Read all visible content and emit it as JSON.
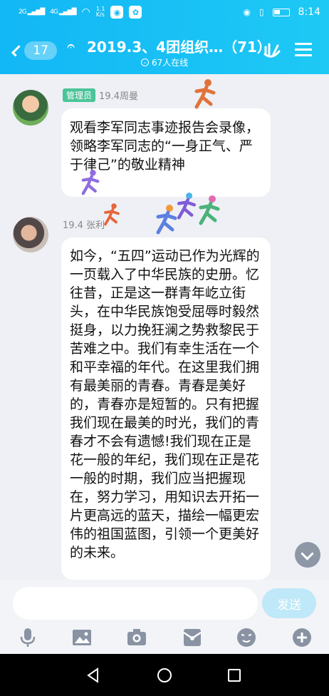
{
  "status_bar": {
    "signal1": "2G",
    "signal2": "4G",
    "net_speed_value": "1.1",
    "net_speed_unit": "K/s",
    "time": "8:14"
  },
  "header": {
    "unread_count": "17",
    "title": "2019.3、4团组织…（71）",
    "online": "67人在线"
  },
  "messages": [
    {
      "badge": "管理员",
      "sender": "19.4周曼",
      "text": "观看李军同志事迹报告会录像，领略李军同志的“一身正气、严于律己”的敬业精神"
    },
    {
      "badge": "",
      "sender": "19.4 张利",
      "text": "如今，“五四”运动已作为光辉的一页载入了中华民族的史册。忆往昔，正是这一群青年屹立街头，在中华民族饱受屈辱时毅然挺身，以力挽狂澜之势救黎民于苦难之中。我们有幸生活在一个和平幸福的年代。在这里我们拥有最美丽的青春。青春是美好的，青春亦是短暂的。只有把握我们现在最美的时光，我们的青春才不会有遗憾!我们现在正是花一般的年纪，我们现在正是花一般的时期，我们应当把握现在，努力学习，用知识去开拓一片更高远的蓝天，描绘一幅更宏伟的祖国蓝图，引领一个更美好的未来。"
    }
  ],
  "input": {
    "placeholder": "",
    "send_label": "发送"
  },
  "colors": {
    "header": "#12b7f5",
    "admin_badge": "#4cc49a",
    "send_disabled": "#bfe8f8"
  },
  "icons": {
    "toolbar": [
      "microphone-icon",
      "image-icon",
      "camera-icon",
      "red-packet-icon",
      "emoji-icon",
      "plus-icon"
    ],
    "nav": [
      "back-triangle-icon",
      "home-circle-icon",
      "recents-square-icon"
    ]
  }
}
